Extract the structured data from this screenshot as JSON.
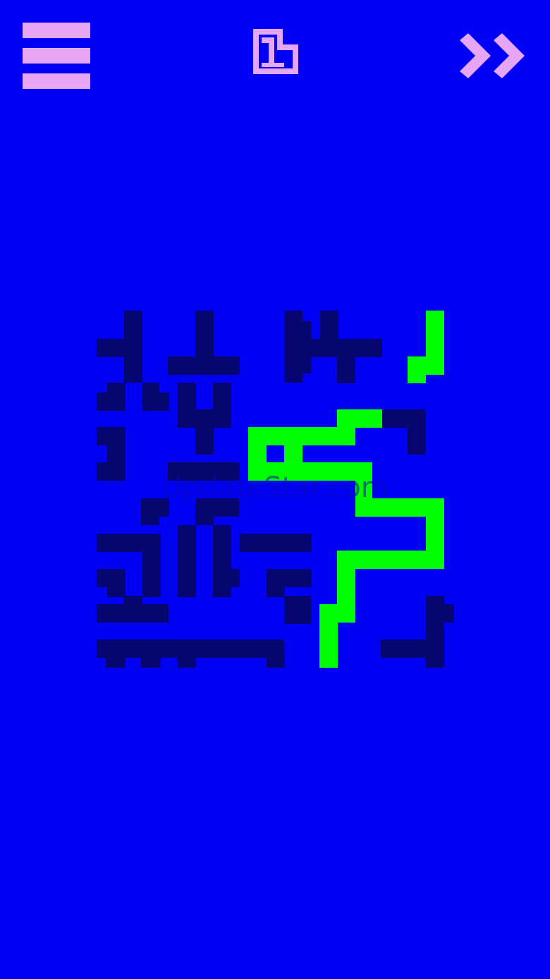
{
  "colors": {
    "background": "#0000f5",
    "ui_accent": "#e6a6f5",
    "tile_dark": "#06066e",
    "path_active": "#00ff00"
  },
  "header": {
    "menu_icon": "hamburger-menu-icon",
    "level_number": "1",
    "skip_icon": "fast-forward-icon"
  },
  "watermark": {
    "text": "UpdateStar.com"
  }
}
